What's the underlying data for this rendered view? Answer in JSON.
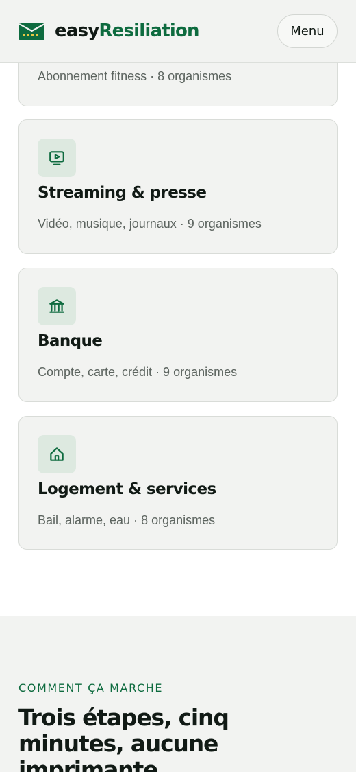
{
  "header": {
    "logo_part1": "easy",
    "logo_part2": "Resiliation",
    "menu_label": "Menu"
  },
  "cards": [
    {
      "title": "",
      "subtitle": "Abonnement fitness · 8 organismes"
    },
    {
      "icon": "tv-play-icon",
      "title": "Streaming & presse",
      "subtitle": "Vidéo, musique, journaux · 9 organismes"
    },
    {
      "icon": "bank-icon",
      "title": "Banque",
      "subtitle": "Compte, carte, crédit · 9 organismes"
    },
    {
      "icon": "house-icon",
      "title": "Logement & services",
      "subtitle": "Bail, alarme, eau · 8 organismes"
    }
  ],
  "how_it_works": {
    "eyebrow": "COMMENT ÇA MARCHE",
    "heading": "Trois étapes, cinq minutes, aucune imprimante."
  },
  "colors": {
    "brand_green": "#0e6b3f",
    "card_bg": "#f2f3f1",
    "icon_bg": "#dde9e0"
  }
}
